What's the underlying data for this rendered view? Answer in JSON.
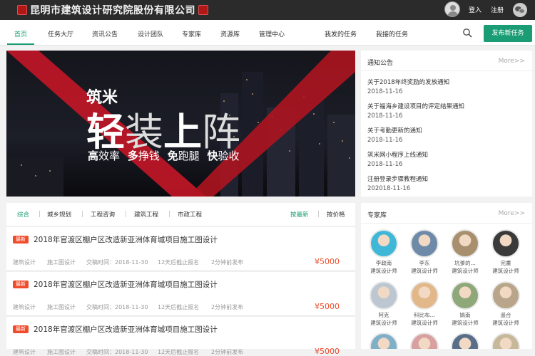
{
  "header": {
    "company_name": "昆明市建筑设计研究院股份有限公司",
    "login": "登入",
    "register": "注册"
  },
  "nav": {
    "items": [
      "首页",
      "任务大厅",
      "资讯公告",
      "设计团队",
      "专家库",
      "资源库",
      "管理中心",
      "我发的任务",
      "我接的任务"
    ],
    "publish_button": "发布新任务"
  },
  "banner": {
    "brand": "筑米",
    "headline": [
      "轻",
      "装",
      "上",
      "阵"
    ],
    "slogan": [
      {
        "bold": "高",
        "rest": "效率"
      },
      {
        "bold": "多",
        "rest": "挣钱"
      },
      {
        "bold": "免",
        "rest": "跑腿"
      },
      {
        "bold": "快",
        "rest": "验收"
      }
    ]
  },
  "notices": {
    "title": "通知公告",
    "more": "More>>",
    "items": [
      {
        "title": "关于2018年终奖励的发放通知",
        "date": "2018-11-16"
      },
      {
        "title": "关于福海乡建设项目的评定结果通知",
        "date": "2018-11-16"
      },
      {
        "title": "关于考勤更新的通知",
        "date": "2018-11-16"
      },
      {
        "title": "筑米网小程序上线通知",
        "date": "2018-11-16"
      },
      {
        "title": "注册登录步骤教程通知",
        "date": "202018-11-16"
      }
    ]
  },
  "filters": {
    "categories": [
      "综合",
      "城乡规划",
      "工程咨询",
      "建筑工程",
      "市政工程"
    ],
    "sort": [
      "按最新",
      "按价格"
    ]
  },
  "tasks": [
    {
      "badge": "最新",
      "title": "2018年官渡区棚户区改造新亚洲体育城项目施工图设计",
      "type": "建筑设计",
      "stage": "施工图设计",
      "deadline": "交稿时间：2018-11-30",
      "remaining": "12天后截止报名",
      "published": "2分钟前发布",
      "price": "¥5000"
    },
    {
      "badge": "最新",
      "title": "2018年官渡区棚户区改造新亚洲体育城项目施工图设计",
      "type": "建筑设计",
      "stage": "施工图设计",
      "deadline": "交稿时间：2018-11-30",
      "remaining": "12天后截止报名",
      "published": "2分钟前发布",
      "price": "¥5000"
    },
    {
      "badge": "最新",
      "title": "2018年官渡区棚户区改造新亚洲体育城项目施工图设计",
      "type": "建筑设计",
      "stage": "施工图设计",
      "deadline": "交稿时间：2018-11-30",
      "remaining": "12天后截止报名",
      "published": "2分钟前发布",
      "price": "¥5000"
    }
  ],
  "experts": {
    "title": "专家库",
    "more": "More>>",
    "items": [
      {
        "name": "李政南",
        "role": "建筑设计师",
        "color": "#3fb8d8"
      },
      {
        "name": "李东",
        "role": "建筑设计师",
        "color": "#6f8aa8"
      },
      {
        "name": "坑爹的...",
        "role": "建筑设计师",
        "color": "#a88f6e"
      },
      {
        "name": "完畫",
        "role": "建筑设计师",
        "color": "#3a3a3a"
      },
      {
        "name": "阿克",
        "role": "建筑设计师",
        "color": "#bcc7d2"
      },
      {
        "name": "科比布...",
        "role": "建筑设计师",
        "color": "#e2b88a"
      },
      {
        "name": "嫣南",
        "role": "建筑设计师",
        "color": "#8fa87a"
      },
      {
        "name": "遥合",
        "role": "建筑设计师",
        "color": "#b9a58a"
      },
      {
        "name": "",
        "role": "",
        "color": "#7fb0c8"
      },
      {
        "name": "",
        "role": "",
        "color": "#d9a0a0"
      },
      {
        "name": "",
        "role": "",
        "color": "#5a6e8a"
      },
      {
        "name": "",
        "role": "",
        "color": "#c8b89a"
      }
    ]
  }
}
